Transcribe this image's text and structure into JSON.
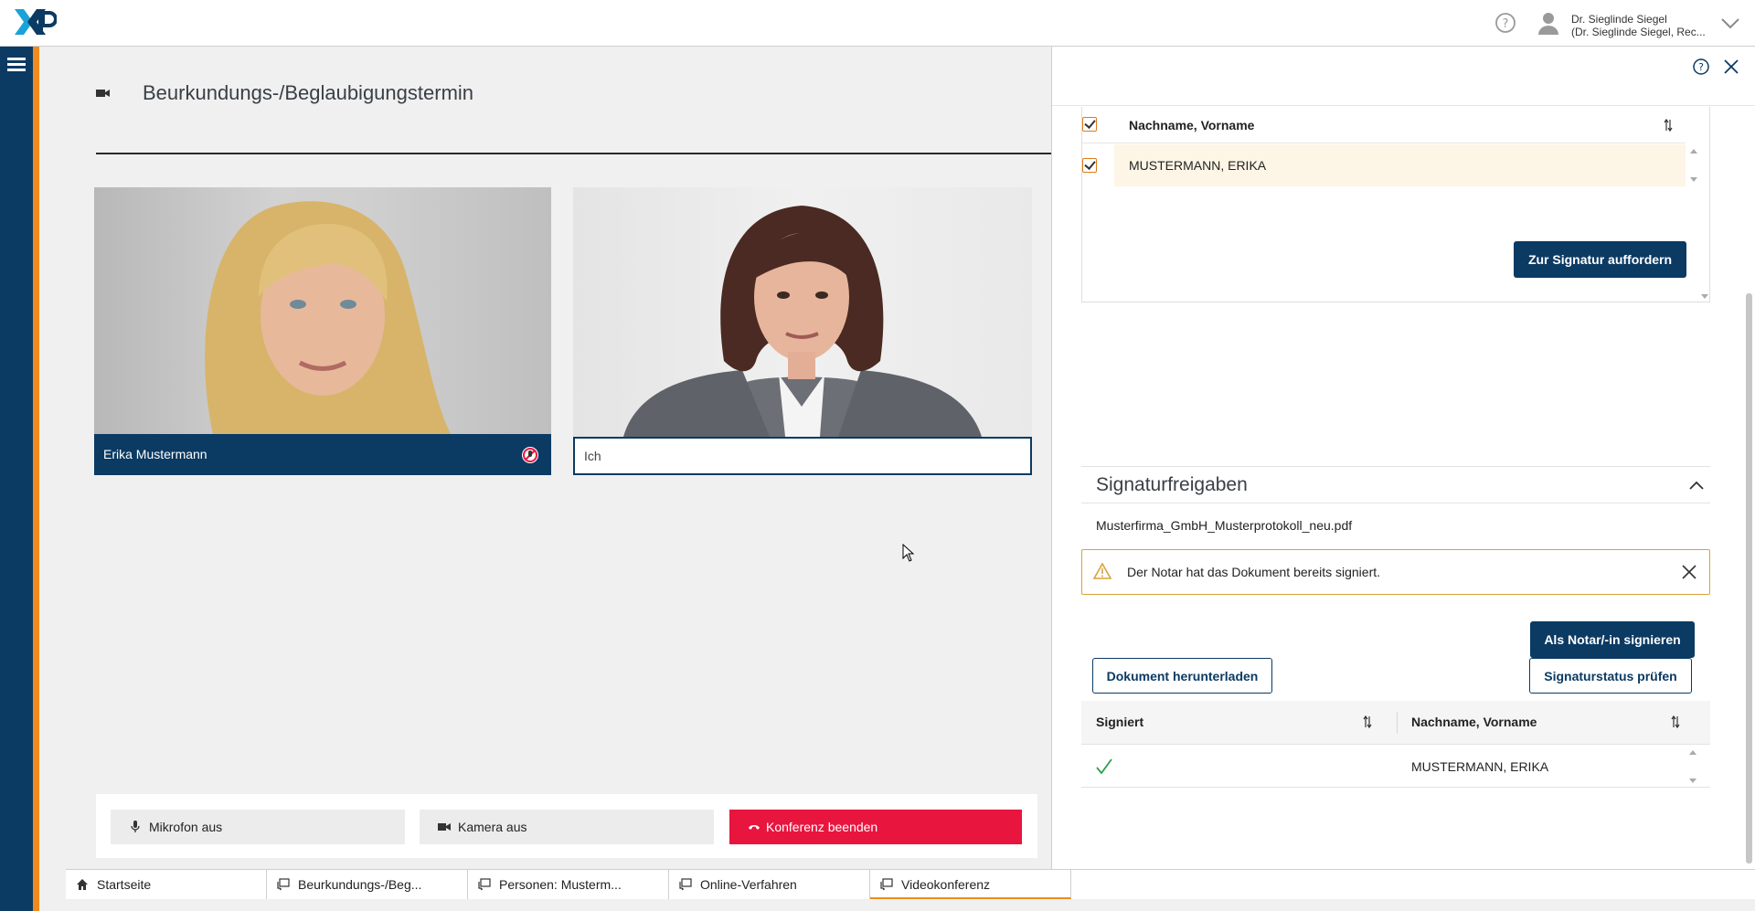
{
  "header": {
    "logo_text": "XNP",
    "user_name": "Dr. Sieglinde Siegel",
    "user_role": "(Dr. Sieglinde Siegel, Rec..."
  },
  "main": {
    "title": "Beurkundungs-/Beglaubigungstermin",
    "video_remote_name": "Erika Mustermann",
    "video_self_name": "Ich",
    "controls": {
      "mic_label": "Mikrofon aus",
      "camera_label": "Kamera aus",
      "end_label": "Konferenz beenden"
    }
  },
  "panel": {
    "request_table": {
      "column": "Nachname, Vorname",
      "rows": [
        "MUSTERMANN, ERIKA"
      ],
      "request_button": "Zur Signatur auffordern"
    },
    "section_title": "Signaturfreigaben",
    "filename": "Musterfirma_GmbH_Musterprotokoll_neu.pdf",
    "warning": "Der Notar hat das Dokument bereits signiert.",
    "buttons": {
      "sign_notary": "Als Notar/-in signieren",
      "download": "Dokument herunterladen",
      "check_status": "Signaturstatus prüfen"
    },
    "status_table": {
      "col_signed": "Signiert",
      "col_name": "Nachname, Vorname",
      "rows": [
        {
          "name": "MUSTERMANN, ERIKA"
        }
      ]
    }
  },
  "tabs": [
    {
      "label": "Startseite"
    },
    {
      "label": "Beurkundungs-/Beg..."
    },
    {
      "label": "Personen: Musterm..."
    },
    {
      "label": "Online-Verfahren"
    },
    {
      "label": "Videokonferenz"
    }
  ],
  "colors": {
    "brand_navy": "#0b3a63",
    "accent_orange": "#f08a1d",
    "danger_red": "#e8153f",
    "warning_border": "#d9a33a"
  }
}
